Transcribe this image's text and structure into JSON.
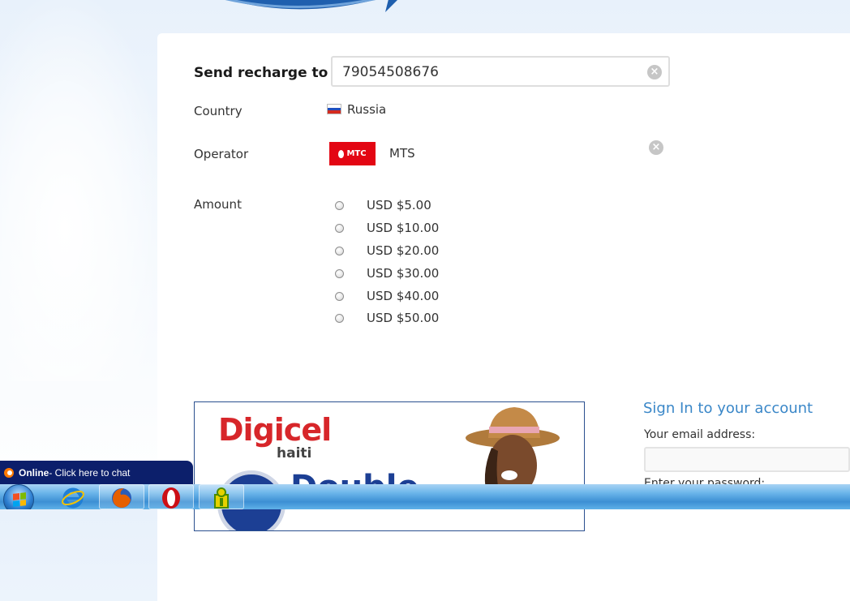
{
  "recharge": {
    "send_label": "Send recharge to",
    "phone_value": "79054508676",
    "country_label": "Country",
    "country_value": "Russia",
    "operator_label": "Operator",
    "operator_logo_text": "МТС",
    "operator_value": "MTS",
    "amount_label": "Amount",
    "amounts": [
      "USD $5.00",
      "USD $10.00",
      "USD $20.00",
      "USD $30.00",
      "USD $40.00",
      "USD $50.00"
    ]
  },
  "ad": {
    "brand": "Digicel",
    "brand_sub": "haiti",
    "headline_partial": "Double"
  },
  "signin": {
    "title": "Sign In to your account",
    "email_label": "Your email address:",
    "email_value": "",
    "password_label_partial": "Enter your password:"
  },
  "chat": {
    "status": "Online",
    "message": " - Click here to chat"
  },
  "taskbar": {
    "items": [
      "start-button",
      "internet-explorer",
      "firefox",
      "opera",
      "app"
    ]
  },
  "colors": {
    "accent_blue": "#3a87c8",
    "mts_red": "#e30613",
    "digicel_red": "#d7262a",
    "chat_navy": "#0c1f6b"
  }
}
